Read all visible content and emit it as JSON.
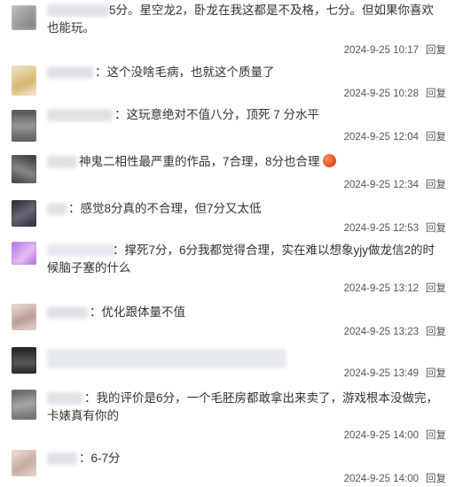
{
  "comments": [
    {
      "text": "5分。星空龙2，卧龙在我这都是不及格，七分。但如果你喜欢也能玩。",
      "time": "2024-9-25 10:17",
      "reply": "回复"
    },
    {
      "text": "：这个没啥毛病，也就这个质量了",
      "time": "2024-9-25 10:28",
      "reply": "回复"
    },
    {
      "text": "：这玩意绝对不值八分，顶死 7 分水平",
      "time": "2024-9-25 12:04",
      "reply": "回复"
    },
    {
      "text": "神鬼二相性最严重的作品，7合理，8分也合理",
      "time": "2024-9-25 12:34",
      "reply": "回复"
    },
    {
      "text": "：感觉8分真的不合理，但7分又太低",
      "time": "2024-9-25 12:53",
      "reply": "回复"
    },
    {
      "text": "：撑死7分，6分我都觉得合理，实在难以想象yjy做龙信2的时候脑子塞的什么",
      "time": "2024-9-25 13:12",
      "reply": "回复"
    },
    {
      "text": "：优化跟体量不值",
      "time": "2024-9-25 13:23",
      "reply": "回复"
    },
    {
      "text": "",
      "time": "2024-9-25 13:49",
      "reply": "回复"
    },
    {
      "text": "：我的评价是6分，一个毛胚房都敢拿出来卖了，游戏根本没做完，卡婊真有你的",
      "time": "2024-9-25 14:00",
      "reply": "回复"
    },
    {
      "text": "：6-7分",
      "time": "2024-9-25 14:00",
      "reply": "回复"
    }
  ],
  "colors": {
    "text": "#333333",
    "meta": "#555555",
    "background": "#ffffff"
  }
}
